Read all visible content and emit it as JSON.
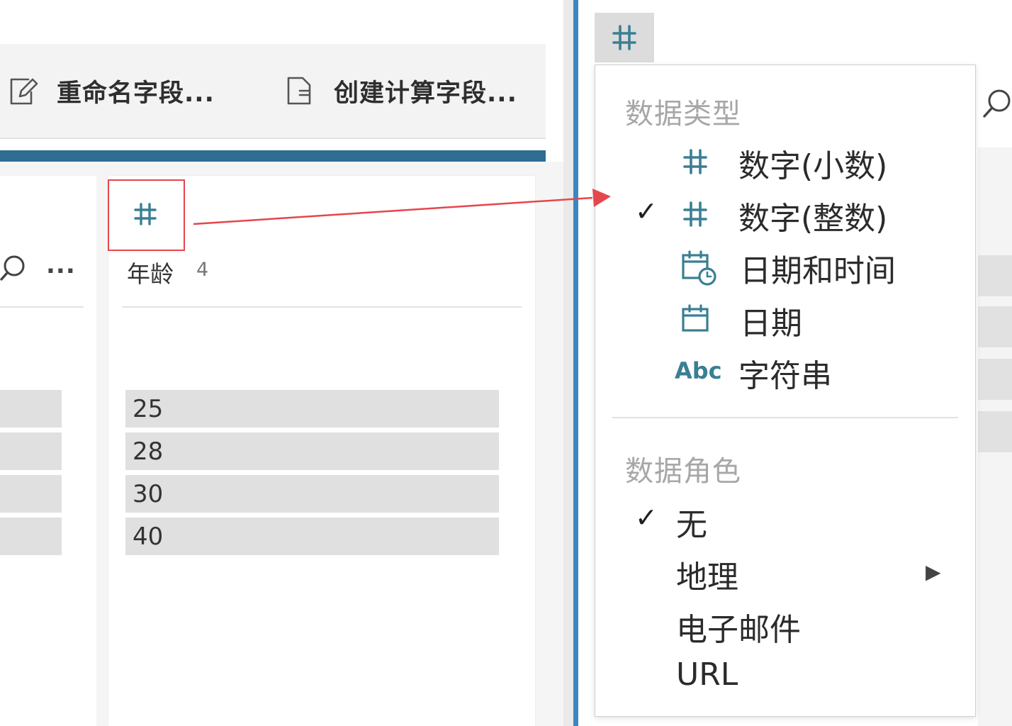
{
  "toolbar": {
    "rename_label": "重命名字段...",
    "calc_label": "创建计算字段..."
  },
  "left_column": {
    "more_label": "..."
  },
  "field": {
    "type_symbol": "#",
    "name": "年龄",
    "count": "4",
    "values": [
      "25",
      "28",
      "30",
      "40"
    ]
  },
  "type_button": {
    "symbol": "#"
  },
  "menu": {
    "data_type_header": "数据类型",
    "data_types": [
      {
        "icon": "hash-icon",
        "symbol": "#",
        "label": "数字(小数)",
        "checked": false
      },
      {
        "icon": "hash-icon",
        "symbol": "#",
        "label": "数字(整数)",
        "checked": true
      },
      {
        "icon": "calendar-clock-icon",
        "label": "日期和时间",
        "checked": false
      },
      {
        "icon": "calendar-icon",
        "label": "日期",
        "checked": false
      },
      {
        "icon": "abc-icon",
        "symbol": "Abc",
        "label": "字符串",
        "checked": false
      }
    ],
    "data_role_header": "数据角色",
    "data_roles": [
      {
        "label": "无",
        "checked": true
      },
      {
        "label": "地理",
        "checked": false,
        "has_submenu": true
      },
      {
        "label": "电子邮件",
        "checked": false
      },
      {
        "label": "URL",
        "checked": false
      }
    ],
    "check_symbol": "✓",
    "submenu_symbol": "▶"
  },
  "colors": {
    "accent_blue": "#2f6d93",
    "divider_blue": "#3a87c3",
    "icon_teal": "#3a7f93",
    "callout_red": "#e5464c"
  }
}
